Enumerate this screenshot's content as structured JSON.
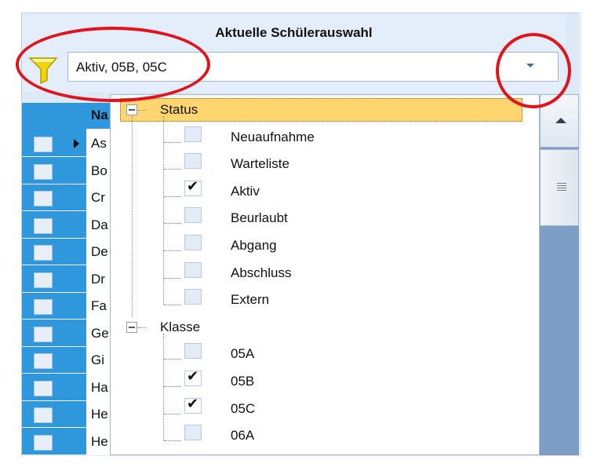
{
  "header": {
    "title": "Aktuelle Schülerauswahl",
    "filter_value": "Aktiv, 05B, 05C"
  },
  "grid": {
    "column_header": "Na",
    "rows": [
      "As",
      "Bo",
      "Cr",
      "Da",
      "De",
      "Dr",
      "Fa",
      "Ge",
      "Gi",
      "Ha",
      "He",
      "He"
    ]
  },
  "tree": {
    "groups": [
      {
        "label": "Status",
        "items": [
          {
            "label": "Neuaufnahme",
            "checked": false
          },
          {
            "label": "Warteliste",
            "checked": false
          },
          {
            "label": "Aktiv",
            "checked": true
          },
          {
            "label": "Beurlaubt",
            "checked": false
          },
          {
            "label": "Abgang",
            "checked": false
          },
          {
            "label": "Abschluss",
            "checked": false
          },
          {
            "label": "Extern",
            "checked": false
          }
        ]
      },
      {
        "label": "Klasse",
        "items": [
          {
            "label": "05A",
            "checked": false
          },
          {
            "label": "05B",
            "checked": true
          },
          {
            "label": "05C",
            "checked": true
          },
          {
            "label": "06A",
            "checked": false
          }
        ]
      }
    ],
    "check_mark": "✔"
  },
  "colors": {
    "accent_blue": "#2f97dc",
    "selection": "#ffd56f",
    "annotation_red": "#e2131b",
    "funnel_yellow": "#f2d40a"
  },
  "icons": {
    "filter": "funnel-icon",
    "dropdown": "chevron-down-icon",
    "scroll_up": "arrow-up-icon"
  }
}
